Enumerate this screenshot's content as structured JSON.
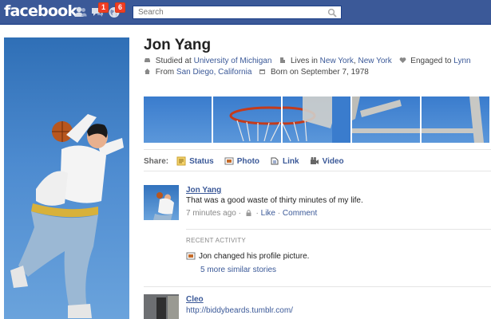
{
  "topbar": {
    "logo": "facebook",
    "friend_requests_count": "",
    "messages_count": "1",
    "notifications_count": "6",
    "search_placeholder": "Search"
  },
  "profile": {
    "name": "Jon Yang",
    "studied_prefix": "Studied at",
    "school": "University of Michigan",
    "lives_prefix": "Lives in",
    "city": "New York",
    "state": "New York",
    "engaged_prefix": "Engaged to",
    "partner": "Lynn",
    "from_prefix": "From",
    "hometown": "San Diego, California",
    "born_text": "Born on September 7, 1978"
  },
  "share": {
    "label": "Share:",
    "options": [
      "Status",
      "Photo",
      "Link",
      "Video"
    ]
  },
  "story": {
    "author": "Jon Yang",
    "text": "That was a good waste of thirty minutes of my life.",
    "time": "7 minutes ago",
    "like": "Like",
    "comment": "Comment"
  },
  "recent_activity": {
    "heading": "RECENT ACTIVITY",
    "item": "Jon changed his profile picture.",
    "more": "5 more similar stories"
  },
  "next_story": {
    "author": "Cleo",
    "link": "http://biddybeards.tumblr.com/"
  },
  "colors": {
    "brand": "#3b5998",
    "sky": "#4d8bd0",
    "badge": "#f03d25"
  }
}
